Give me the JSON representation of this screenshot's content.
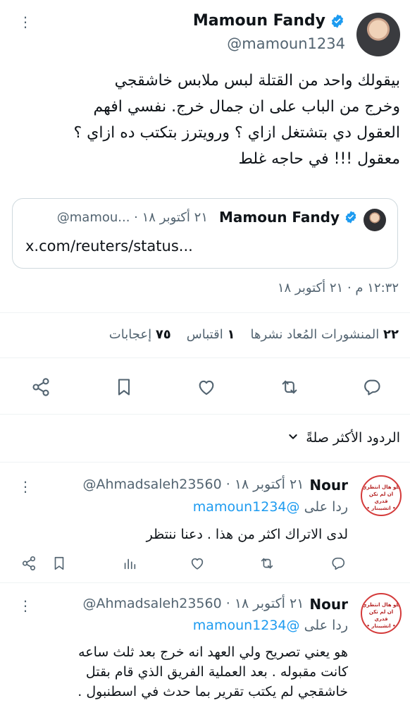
{
  "tweet": {
    "author_name": "Mamoun Fandy",
    "author_handle": "@mamoun1234",
    "text_lines": [
      "بيقولك واحد من القتلة لبس ملابس خاشقجي",
      "وخرج من الباب على ان جمال خرج. نفسي افهم",
      "العقول دي بتشتغل ازاي ؟ ورويترز بتكتب ده ازاي ؟",
      "معقول !!! في حاجه غلط"
    ],
    "quoted": {
      "author_name": "Mamoun Fandy",
      "meta": "@mamou... · ٢١ أكتوبر ١٨",
      "link_text": "x.com/reuters/status..."
    },
    "timestamp": "١٢:٣٢ م · ٢١ أكتوبر ١٨",
    "stats": {
      "reposts_count": "٢٢",
      "reposts_label": "المنشورات المُعاد نشرها",
      "quotes_count": "١",
      "quotes_label": "اقتباس",
      "likes_count": "٧٥",
      "likes_label": "إعجابات"
    },
    "icons": [
      "reply-icon",
      "repost-icon",
      "like-icon",
      "bookmark-icon",
      "share-icon"
    ]
  },
  "replies_sort": {
    "label": "الردود الأكثر صلةً"
  },
  "replies": [
    {
      "name": "Nour",
      "handle_date": "@Ahmadsaleh23560 · ٢١ أكتوبر ١٨",
      "replying_to_prefix": "ردا على",
      "replying_to_handle": "@mamoun1234",
      "text_lines": [
        "لدى الاتراك اكثر من هذا . دعنا ننتظر"
      ],
      "avatar_text": [
        "بلو هال انتظري",
        "ان لم تكن قدري",
        "• اتشيبنار •"
      ]
    },
    {
      "name": "Nour",
      "handle_date": "@Ahmadsaleh23560 · ٢١ أكتوبر ١٨",
      "replying_to_prefix": "ردا على",
      "replying_to_handle": "@mamoun1234",
      "text_lines": [
        "هو يعني تصريح ولي العهد انه خرج بعد ثلث ساعه",
        "كانت مقبوله . بعد العملية الفريق الذي قام بقتل",
        "خاشقجي لم يكتب تقرير بما حدث في اسطنبول ."
      ],
      "avatar_text": [
        "بلو هال انتظري",
        "ان لم تكن قدري",
        "• اتشيبنار •"
      ]
    }
  ]
}
